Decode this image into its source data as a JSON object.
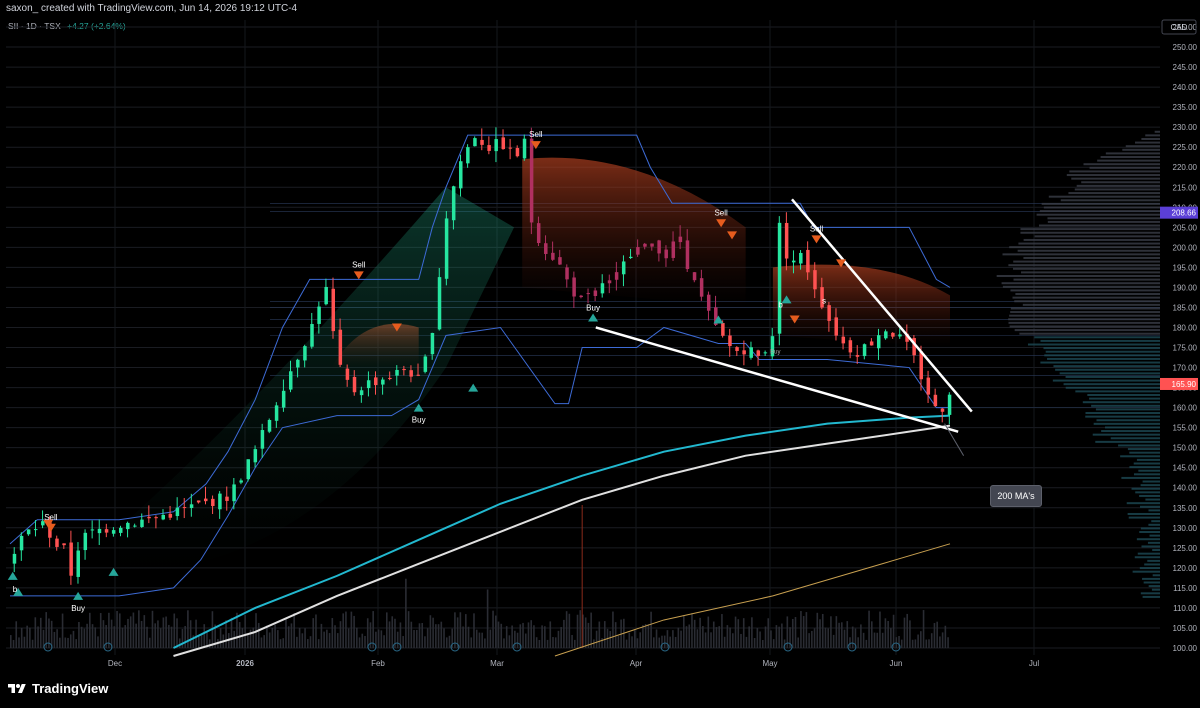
{
  "header": {
    "attribution": "saxon_ created with TradingView.com, Jun 14, 2026 19:12 UTC-4"
  },
  "legend": {
    "symbol": "SII · 1D · TSX",
    "change": "+4.27 (+2.64%)"
  },
  "currency": "CAD",
  "brand": "TradingView",
  "colors": {
    "up": "#26e6a0",
    "down": "#ff5252",
    "pullback": "#b03060",
    "ma_fast": "#22b8cf",
    "ma_slow": "#e0e0e0",
    "ma_long": "#c8a050",
    "band": "#3d6bd6",
    "sell_marker": "#e65c1e",
    "buy_marker": "#26a69a",
    "price_label": "#ff5252",
    "level_label": "#5b3fd6"
  },
  "chart_data": {
    "type": "candlestick",
    "y_axis": {
      "ticks": [
        "255.00",
        "250.00",
        "245.00",
        "240.00",
        "235.00",
        "230.00",
        "225.00",
        "220.00",
        "215.00",
        "210.00",
        "205.00",
        "200.00",
        "195.00",
        "190.00",
        "185.00",
        "180.00",
        "175.00",
        "170.00",
        "165.00",
        "160.00",
        "155.00",
        "150.00",
        "145.00",
        "140.00",
        "135.00",
        "130.00",
        "125.00",
        "120.00",
        "115.00",
        "110.00",
        "105.00",
        "100.00"
      ],
      "ylim": [
        98,
        258
      ]
    },
    "x_axis": {
      "tick_labels": [
        "Dec",
        "2026",
        "Feb",
        "Mar",
        "Apr",
        "May",
        "Jun",
        "Jul"
      ]
    },
    "price_labels": [
      {
        "value": 208.66,
        "text": "208.66"
      },
      {
        "value": 165.9,
        "text": "165.90"
      }
    ],
    "price_approx": [
      [
        0,
        122
      ],
      [
        4,
        128
      ],
      [
        8,
        130
      ],
      [
        12,
        131
      ],
      [
        16,
        126
      ],
      [
        20,
        124
      ],
      [
        22,
        118
      ],
      [
        25,
        127
      ],
      [
        30,
        129
      ],
      [
        40,
        131
      ],
      [
        50,
        132
      ],
      [
        60,
        134
      ],
      [
        70,
        136
      ],
      [
        80,
        138
      ],
      [
        90,
        150
      ],
      [
        100,
        166
      ],
      [
        110,
        180
      ],
      [
        115,
        191
      ],
      [
        120,
        170
      ],
      [
        125,
        164
      ],
      [
        130,
        166
      ],
      [
        140,
        168
      ],
      [
        145,
        170
      ],
      [
        150,
        166
      ],
      [
        155,
        182
      ],
      [
        160,
        210
      ],
      [
        165,
        222
      ],
      [
        170,
        228
      ],
      [
        175,
        225
      ],
      [
        180,
        226
      ],
      [
        185,
        222
      ],
      [
        188,
        228
      ],
      [
        190,
        208
      ],
      [
        195,
        200
      ],
      [
        200,
        197
      ],
      [
        205,
        190
      ],
      [
        210,
        186
      ],
      [
        215,
        190
      ],
      [
        220,
        192
      ],
      [
        225,
        196
      ],
      [
        230,
        200
      ],
      [
        235,
        202
      ],
      [
        240,
        198
      ],
      [
        245,
        202
      ],
      [
        250,
        192
      ],
      [
        255,
        184
      ],
      [
        260,
        178
      ],
      [
        265,
        174
      ],
      [
        270,
        175
      ],
      [
        275,
        172
      ],
      [
        280,
        180
      ],
      [
        282,
        208
      ],
      [
        285,
        196
      ],
      [
        290,
        198
      ],
      [
        295,
        190
      ],
      [
        300,
        182
      ],
      [
        305,
        176
      ],
      [
        310,
        174
      ],
      [
        315,
        176
      ],
      [
        320,
        180
      ],
      [
        325,
        178
      ],
      [
        330,
        174
      ],
      [
        335,
        166
      ],
      [
        340,
        158
      ],
      [
        343,
        162
      ],
      [
        345,
        165.9
      ]
    ],
    "sell_signals": [
      "Sell",
      "Sell",
      "Sell",
      "Sell",
      "Sell"
    ],
    "buy_signals": [
      "Buy",
      "Buy",
      "Buy"
    ],
    "small_labels": [
      "b",
      "b",
      "s",
      "Buy"
    ],
    "annotation": "200 MA's",
    "volume_profile": true,
    "grid": true
  }
}
